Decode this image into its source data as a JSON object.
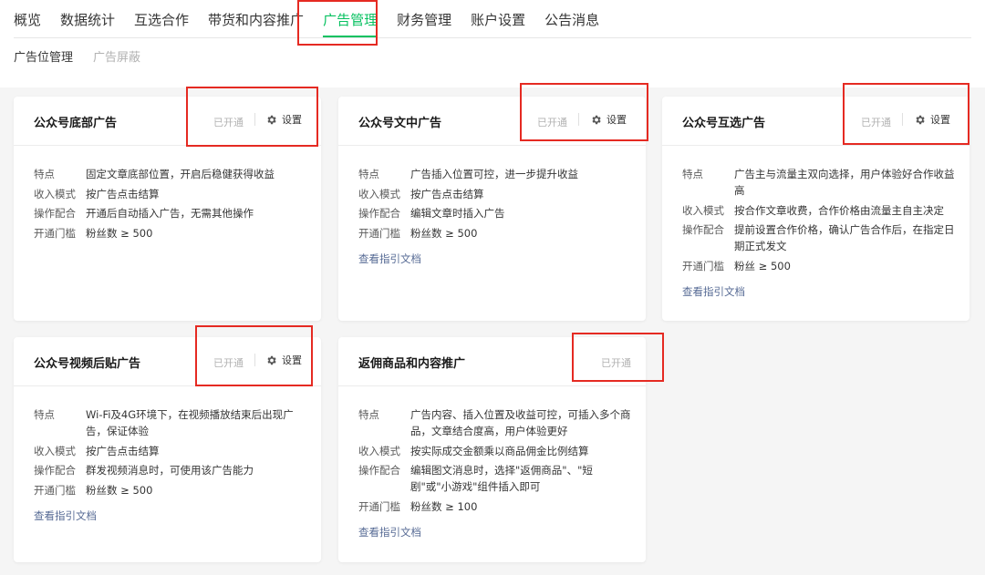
{
  "nav": {
    "items": [
      "概览",
      "数据统计",
      "互选合作",
      "带货和内容推广",
      "广告管理",
      "财务管理",
      "账户设置",
      "公告消息"
    ],
    "active_index": 4
  },
  "subnav": {
    "items": [
      "广告位管理",
      "广告屏蔽"
    ]
  },
  "colors": {
    "accent_green": "#07c160",
    "link_blue": "#576b95",
    "highlight_red": "#e52a22"
  },
  "cards": [
    {
      "title": "公众号底部广告",
      "status": "已开通",
      "settings_label": "设置",
      "settings_icon": "gear-icon",
      "rows": [
        {
          "k": "特点",
          "v": "固定文章底部位置，开启后稳健获得收益"
        },
        {
          "k": "收入模式",
          "v": "按广告点击结算"
        },
        {
          "k": "操作配合",
          "v": "开通后自动插入广告，无需其他操作"
        },
        {
          "k": "开通门槛",
          "v": "粉丝数 ≥ 500"
        }
      ]
    },
    {
      "title": "公众号文中广告",
      "status": "已开通",
      "settings_label": "设置",
      "settings_icon": "gear-icon",
      "rows": [
        {
          "k": "特点",
          "v": "广告插入位置可控，进一步提升收益"
        },
        {
          "k": "收入模式",
          "v": "按广告点击结算"
        },
        {
          "k": "操作配合",
          "v": "编辑文章时插入广告"
        },
        {
          "k": "开通门槛",
          "v": "粉丝数 ≥ 500"
        }
      ],
      "link": "查看指引文档"
    },
    {
      "title": "公众号互选广告",
      "status": "已开通",
      "settings_label": "设置",
      "settings_icon": "gear-icon",
      "rows": [
        {
          "k": "特点",
          "v": "广告主与流量主双向选择，用户体验好合作收益高"
        },
        {
          "k": "收入模式",
          "v": "按合作文章收费，合作价格由流量主自主决定"
        },
        {
          "k": "操作配合",
          "v": "提前设置合作价格，确认广告合作后，在指定日期正式发文"
        },
        {
          "k": "开通门槛",
          "v": "粉丝 ≥ 500"
        }
      ],
      "link": "查看指引文档"
    },
    {
      "title": "公众号视频后贴广告",
      "status": "已开通",
      "settings_label": "设置",
      "settings_icon": "gear-icon",
      "rows": [
        {
          "k": "特点",
          "v": "Wi-Fi及4G环境下，在视频播放结束后出现广告，保证体验"
        },
        {
          "k": "收入模式",
          "v": "按广告点击结算"
        },
        {
          "k": "操作配合",
          "v": "群发视频消息时，可使用该广告能力"
        },
        {
          "k": "开通门槛",
          "v": "粉丝数 ≥ 500"
        }
      ],
      "link": "查看指引文档"
    },
    {
      "title": "返佣商品和内容推广",
      "status": "已开通",
      "rows": [
        {
          "k": "特点",
          "v": "广告内容、插入位置及收益可控，可插入多个商品，文章结合度高，用户体验更好"
        },
        {
          "k": "收入模式",
          "v": "按实际成交金额乘以商品佣金比例结算"
        },
        {
          "k": "操作配合",
          "v": "编辑图文消息时，选择\"返佣商品\"、\"短剧\"或\"小游戏\"组件插入即可"
        },
        {
          "k": "开通门槛",
          "v": "粉丝数 ≥ 100"
        }
      ],
      "link": "查看指引文档"
    }
  ]
}
